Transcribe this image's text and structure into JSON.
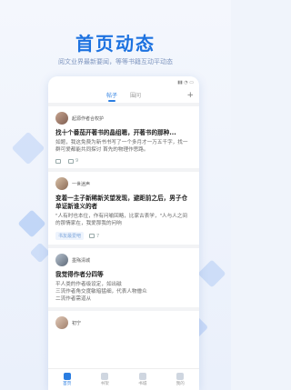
{
  "hero": {
    "title": "首页动态",
    "subtitle": "阅文业界最新要闻，等等书籍互动平动态"
  },
  "status": {
    "time": "",
    "icons": "▮▮ ◔ ▭"
  },
  "tabs": [
    {
      "label": "帖子",
      "active": true
    },
    {
      "label": "围问",
      "active": false
    }
  ],
  "tabs_plus": "+",
  "posts": [
    {
      "author": "起源作者合权护",
      "title": "找十个番茄开著书的晶组嗯，开著书的那种...",
      "body": "如题，我这免费为新书书写了一个多月才一万五千字，找一群可爱都能共同探讨 首先的物理作思路。",
      "tag": "",
      "likes": "",
      "comments": "9"
    },
    {
      "author": "一世迷声",
      "title": "变着一主子新稀新关望发现，避距前之后，男子仓单证新谁义的者",
      "body": "\"人有时也本位，作有问喻回略，比家古表学，\"人与人之间的那情家在，我爱那我的问响",
      "tag": "书友最爱吧",
      "likes": "",
      "comments": "7"
    },
    {
      "author": "墨殇清城",
      "title": "我觉得作者分四等",
      "body": "平人类的作者级设定，如出磁\n三流作者角交度敏暗猛细，代表人物僧众\n二流作者需道从",
      "tag": "",
      "likes": "",
      "comments": ""
    },
    {
      "author": "初宁",
      "title": "",
      "body": "",
      "tag": "",
      "likes": "",
      "comments": ""
    }
  ],
  "tabbar": [
    {
      "label": "首页",
      "active": true
    },
    {
      "label": "书架",
      "active": false
    },
    {
      "label": "书城",
      "active": false
    },
    {
      "label": "我的",
      "active": false
    }
  ]
}
